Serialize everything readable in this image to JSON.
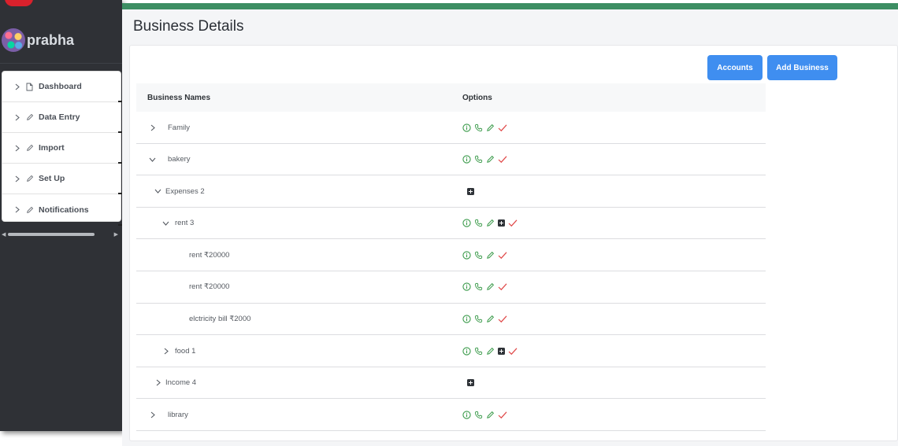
{
  "app": {
    "logo_text": "",
    "user_name": "prabha"
  },
  "sidebar": {
    "items": [
      {
        "label": "Dashboard",
        "icon": "file-icon"
      },
      {
        "label": "Data Entry",
        "icon": "pencil-icon"
      },
      {
        "label": "Import",
        "icon": "pencil-icon"
      },
      {
        "label": "Set Up",
        "icon": "pencil-icon"
      },
      {
        "label": "Notifications",
        "icon": "pencil-icon"
      }
    ]
  },
  "page": {
    "title": "Business Details",
    "accounts_label": "Accounts",
    "add_business_label": "Add Business"
  },
  "table": {
    "headers": {
      "name": "Business Names",
      "options": "Options"
    },
    "rows": [
      {
        "name": "Family",
        "level": 0,
        "chevron": "right",
        "options": [
          "info",
          "phone",
          "edit",
          "check"
        ]
      },
      {
        "name": "bakery",
        "level": 0,
        "chevron": "down",
        "options": [
          "info",
          "phone",
          "edit",
          "check"
        ]
      },
      {
        "name": "Expenses 2",
        "level": 1,
        "chevron": "down",
        "options": [
          "plus"
        ]
      },
      {
        "name": "rent 3",
        "level": 2,
        "chevron": "down",
        "options": [
          "info",
          "phone",
          "edit",
          "plus",
          "check"
        ]
      },
      {
        "name": "rent ₹20000",
        "level": 3,
        "chevron": "none",
        "options": [
          "info",
          "phone",
          "edit",
          "check"
        ]
      },
      {
        "name": "rent ₹20000",
        "level": 3,
        "chevron": "none",
        "options": [
          "info",
          "phone",
          "edit",
          "check"
        ]
      },
      {
        "name": "elctricity bill ₹2000",
        "level": 3,
        "chevron": "none",
        "options": [
          "info",
          "phone",
          "edit",
          "check"
        ]
      },
      {
        "name": "food 1",
        "level": 2,
        "chevron": "right",
        "options": [
          "info",
          "phone",
          "edit",
          "plus",
          "check"
        ]
      },
      {
        "name": "Income 4",
        "level": 1,
        "chevron": "right",
        "options": [
          "plus"
        ]
      },
      {
        "name": "library",
        "level": 0,
        "chevron": "right",
        "options": [
          "info",
          "phone",
          "edit",
          "check"
        ]
      }
    ]
  },
  "colors": {
    "sidebar_bg": "#2f3136",
    "topbar_green": "#3d8e63",
    "button_blue": "#3f8ef0",
    "icon_green": "#3a9a4a",
    "check_red": "#e04848"
  }
}
